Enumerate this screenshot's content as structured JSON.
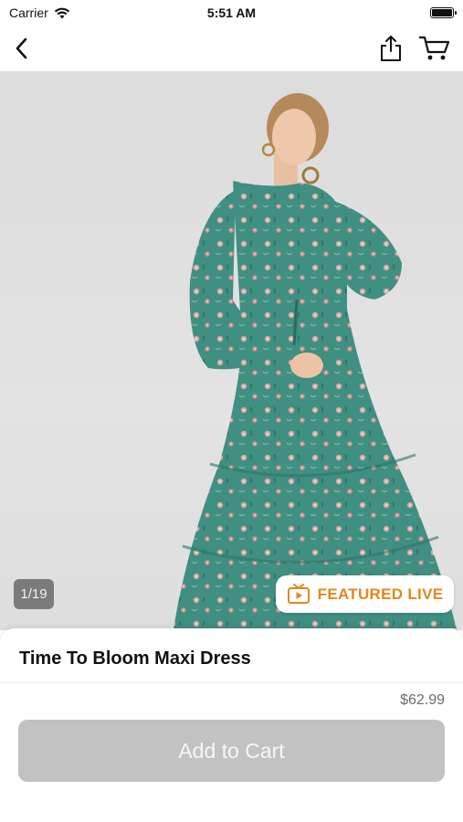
{
  "status_bar": {
    "carrier": "Carrier",
    "time": "5:51 AM"
  },
  "nav": {
    "back_icon": "chevron-left-icon",
    "share_icon": "share-icon",
    "cart_icon": "cart-icon"
  },
  "product": {
    "image_counter": "1/19",
    "featured_label": "FEATURED LIVE",
    "title": "Time To Bloom Maxi Dress",
    "price": "$62.99",
    "add_to_cart_label": "Add to Cart"
  },
  "colors": {
    "featured_accent": "#e3871c",
    "button_disabled": "#c2c2c2",
    "dress_teal": "#3f8f82"
  }
}
